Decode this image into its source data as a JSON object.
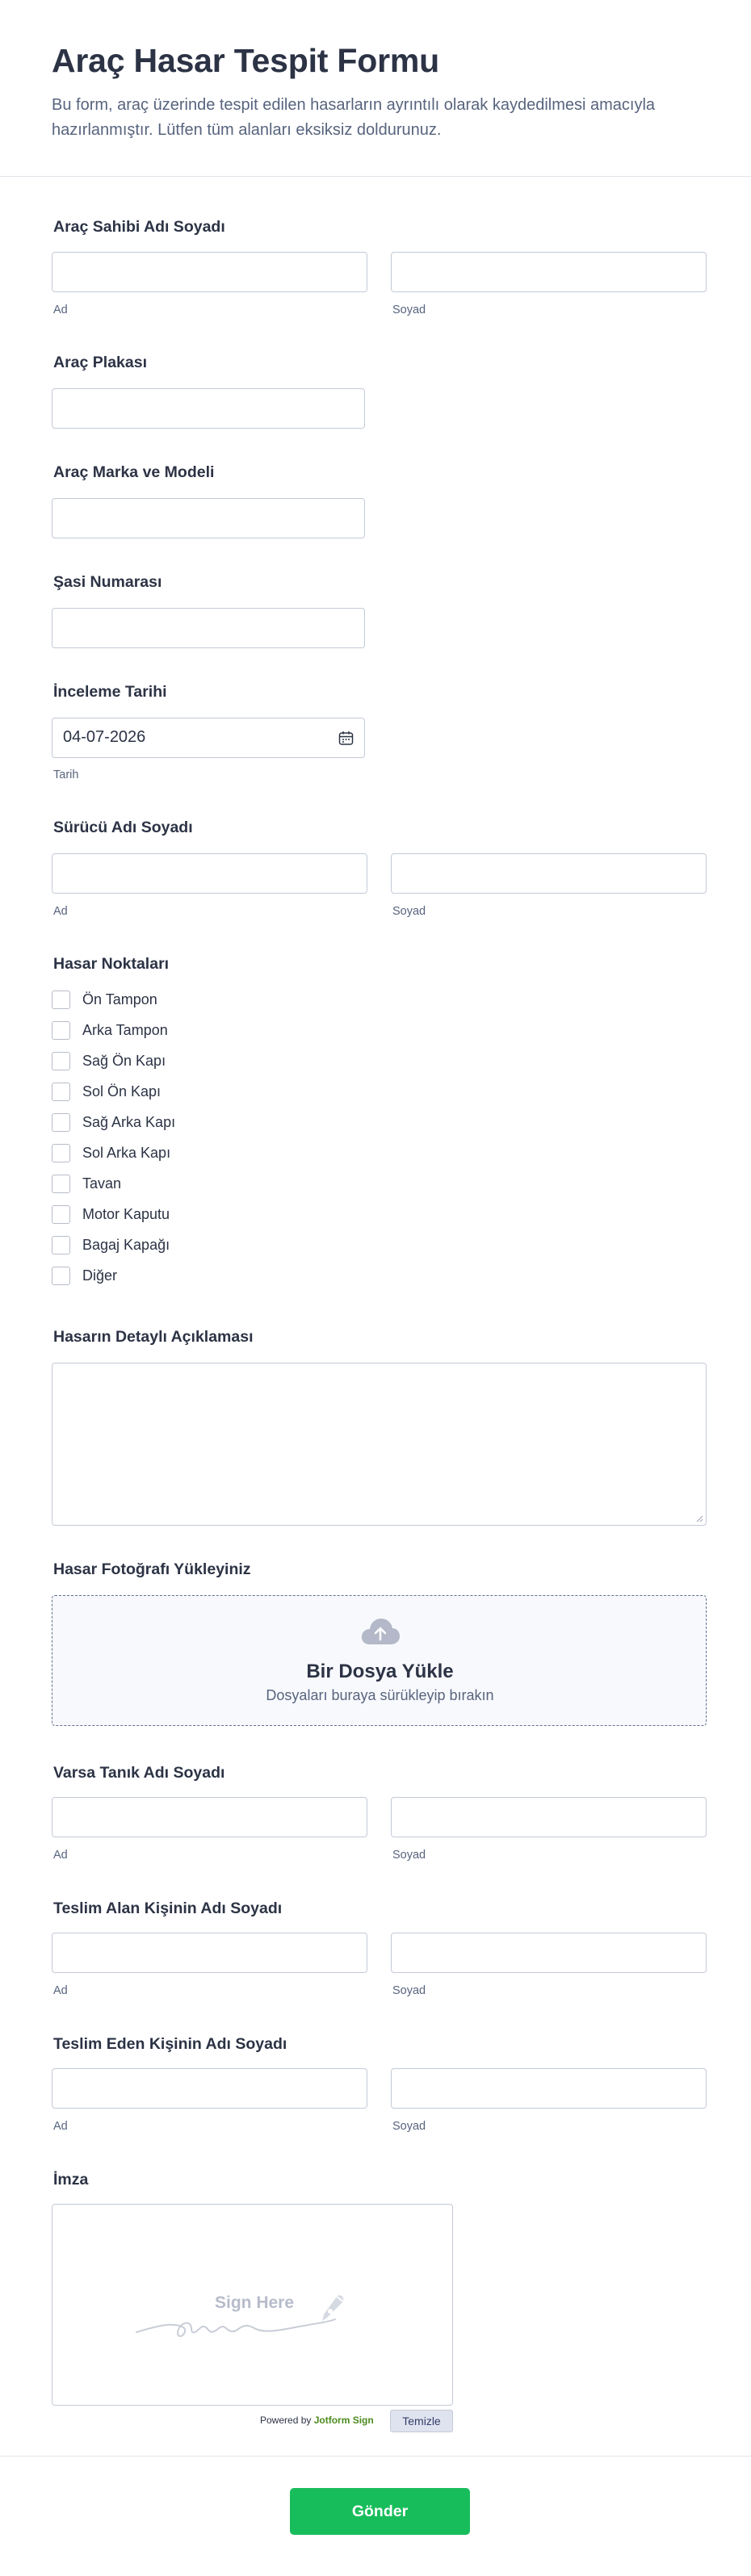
{
  "header": {
    "title": "Araç Hasar Tespit Formu",
    "description": "Bu form, araç üzerinde tespit edilen hasarların ayrıntılı olarak kaydedilmesi amacıyla hazırlanmıştır. Lütfen tüm alanları eksiksiz doldurunuz."
  },
  "fields": {
    "owner_name": {
      "label": "Araç Sahibi Adı Soyadı",
      "first_sub": "Ad",
      "last_sub": "Soyad",
      "first_value": "",
      "last_value": ""
    },
    "plate": {
      "label": "Araç Plakası",
      "value": ""
    },
    "make_model": {
      "label": "Araç Marka ve Modeli",
      "value": ""
    },
    "chassis": {
      "label": "Şasi Numarası",
      "value": ""
    },
    "inspection_date": {
      "label": "İnceleme Tarihi",
      "value": "04-07-2026",
      "sub": "Tarih"
    },
    "driver_name": {
      "label": "Sürücü Adı Soyadı",
      "first_sub": "Ad",
      "last_sub": "Soyad"
    },
    "damage_points": {
      "label": "Hasar Noktaları",
      "options": [
        "Ön Tampon",
        "Arka Tampon",
        "Sağ Ön Kapı",
        "Sol Ön Kapı",
        "Sağ Arka Kapı",
        "Sol Arka Kapı",
        "Tavan",
        "Motor Kaputu",
        "Bagaj Kapağı",
        "Diğer"
      ]
    },
    "description": {
      "label": "Hasarın Detaylı Açıklaması",
      "value": ""
    },
    "photo": {
      "label": "Hasar Fotoğrafı Yükleyiniz",
      "title": "Bir Dosya Yükle",
      "subtitle": "Dosyaları buraya sürükleyip bırakın"
    },
    "witness_name": {
      "label": "Varsa Tanık Adı Soyadı",
      "first_sub": "Ad",
      "last_sub": "Soyad"
    },
    "receiver_name": {
      "label": "Teslim Alan Kişinin Adı Soyadı",
      "first_sub": "Ad",
      "last_sub": "Soyad"
    },
    "deliverer_name": {
      "label": "Teslim Eden Kişinin Adı Soyadı",
      "first_sub": "Ad",
      "last_sub": "Soyad"
    },
    "signature": {
      "label": "İmza",
      "placeholder": "Sign Here",
      "powered_prefix": "Powered by",
      "powered_brand": "Jotform Sign",
      "clear_label": "Temizle"
    }
  },
  "submit_label": "Gönder",
  "colors": {
    "submit": "#18bd5b",
    "text": "#2c3345",
    "muted": "#57647e",
    "border": "#c3cad8"
  }
}
